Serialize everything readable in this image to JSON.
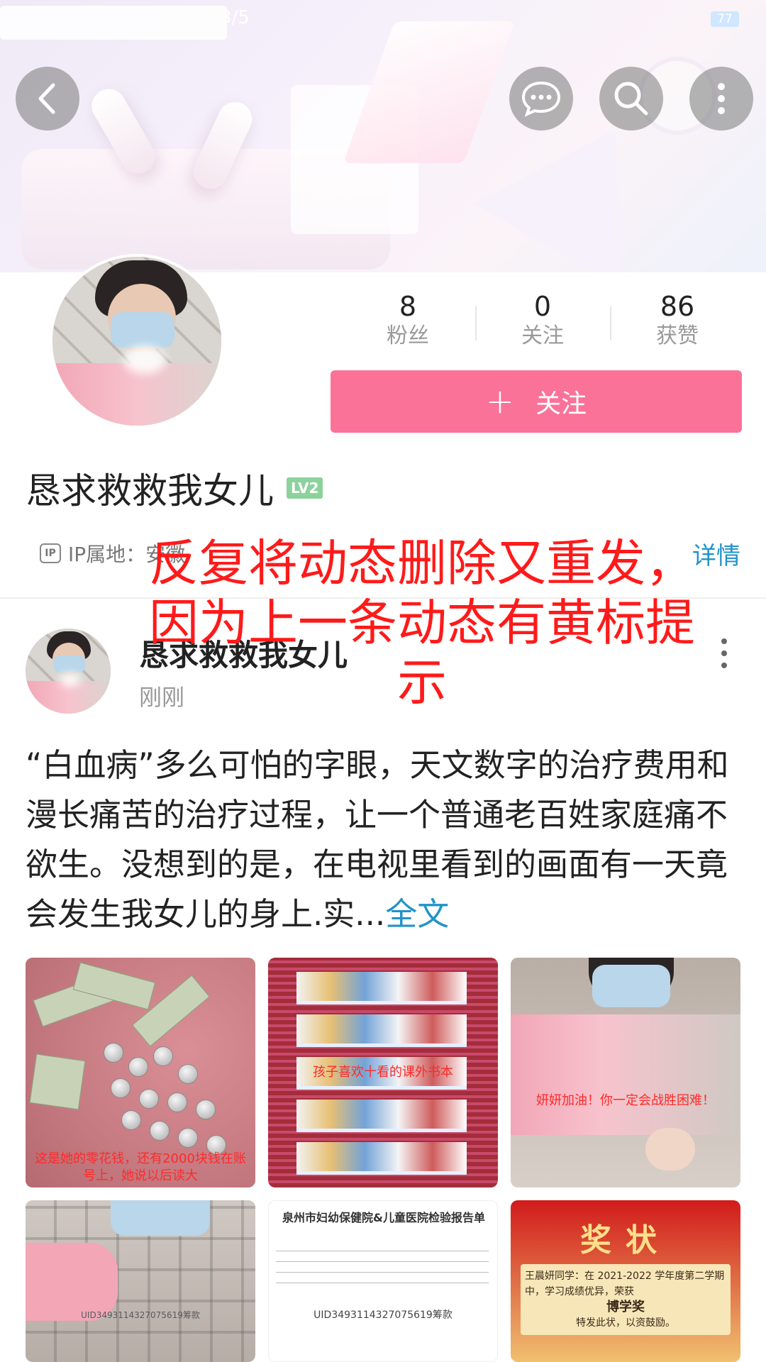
{
  "status_bar": {
    "text": "3/5",
    "battery": "77"
  },
  "top_nav": {
    "back_icon": "chevron-left-icon",
    "message_icon": "chat-bubble-icon",
    "search_icon": "search-icon",
    "more_icon": "more-vertical-icon"
  },
  "profile": {
    "stats": [
      {
        "value": "8",
        "label": "粉丝"
      },
      {
        "value": "0",
        "label": "关注"
      },
      {
        "value": "86",
        "label": "获赞"
      }
    ],
    "follow_button": {
      "icon": "+",
      "label": "关注"
    },
    "username": "恳求救救我女儿",
    "level": "LV2",
    "ip_icon": "IP",
    "ip_label": "IP属地：安徽",
    "detail_link": "详情"
  },
  "overlay_annotation": "反复将动态删除又重发，因为上一条动态有黄标提示",
  "post": {
    "author": "恳求救救我女儿",
    "time": "刚刚",
    "text": "“白血病”多么可怕的字眼，天文数字的治疗费用和漫长痛苦的治疗过程，让一个普通老百姓家庭痛不欲生。没想到的是，在电视里看到的画面有一天竟会发生我女儿的身上.实...",
    "full_link": "全文",
    "images": [
      {
        "caption": "这是她的零花钱，还有2000块钱在账号上，她说以后读大"
      },
      {
        "caption": "孩子喜欢十看的课外书本"
      },
      {
        "caption": "妍妍加油！你一定会战胜困难！"
      },
      {
        "caption": "UID3493114327075619筹款"
      },
      {
        "title": "泉州市妇幼保健院&儿童医院检验报告单",
        "uid": "UID3493114327075619筹款"
      },
      {
        "title": "奖状",
        "body": "王晨妍同学：在 2021-2022 学年度第二学期中，学习成绩优异，荣获",
        "award": "博学奖",
        "footer": "特发此状，以资鼓励。"
      }
    ]
  },
  "colors": {
    "accent_pink": "#fb7299",
    "link_blue": "#2193c9",
    "annotation_red": "#ff1a1a"
  }
}
